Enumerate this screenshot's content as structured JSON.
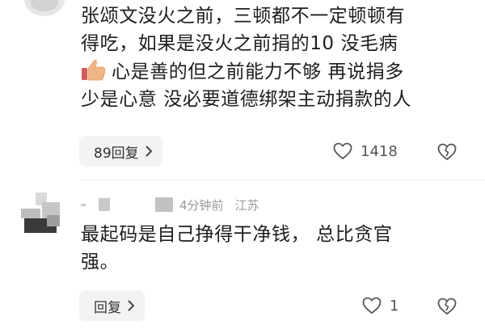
{
  "comment1": {
    "lines": [
      "张颂文没火之前，三顿都不一定顿顿有",
      "得吃，如果是没火之前捐的10 没毛病",
      "心是善的但之前能力不够 再说捐多",
      "少是心意 没必要道德绑架主动捐款的人"
    ],
    "reply_label": "89回复",
    "like_count": "1418"
  },
  "comment2": {
    "time": "4分钟前",
    "location": "江苏",
    "lines": [
      "最起码是自己挣得干净钱， 总比贪官",
      "强。"
    ],
    "reply_label": "回复",
    "like_count": "1"
  },
  "colors": {
    "pill_bg": "#f3f3f3",
    "text": "#1e1e1e",
    "meta": "#9a9a9a",
    "thumb_emoji": "#f2b585"
  },
  "icons": {
    "like": "heart-outline-icon",
    "dislike": "broken-heart-icon",
    "reply_chevron": "chevron-right-icon",
    "thumbs_up": "thumbs-up-emoji"
  }
}
